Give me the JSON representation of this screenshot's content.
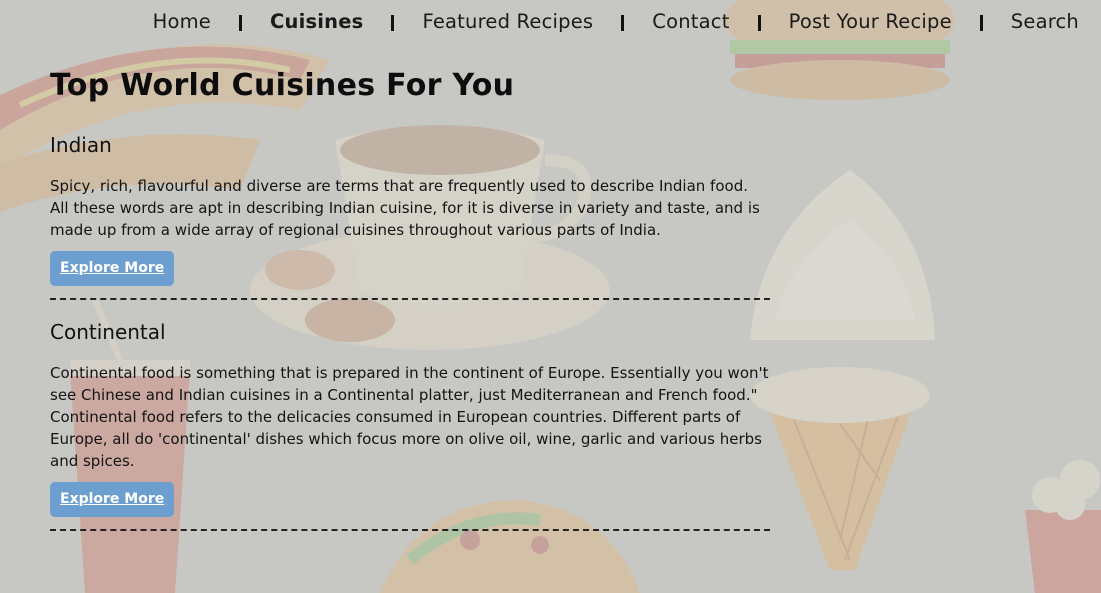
{
  "nav": {
    "items": [
      {
        "label": "Home",
        "active": false
      },
      {
        "label": "Cuisines",
        "active": true
      },
      {
        "label": "Featured Recipes",
        "active": false
      },
      {
        "label": "Contact",
        "active": false
      },
      {
        "label": "Post Your Recipe",
        "active": false
      },
      {
        "label": "Search",
        "active": false
      }
    ]
  },
  "page": {
    "title": "Top World Cuisines For You"
  },
  "cuisines": [
    {
      "name": "Indian",
      "description": "Spicy, rich, flavourful and diverse are terms that are frequently used to describe Indian food. All these words are apt in describing Indian cuisine, for it is diverse in variety and taste, and is made up from a wide array of regional cuisines throughout various parts of India.",
      "button_label": "Explore More"
    },
    {
      "name": "Continental",
      "description": "Continental food is something that is prepared in the continent of Europe. Essentially you won't see Chinese and Indian cuisines in a Continental platter, just Mediterranean and French food.\" Continental food refers to the delicacies consumed in European countries. Different parts of Europe, all do 'continental' dishes which focus more on olive oil, wine, garlic and various herbs and spices.",
      "button_label": "Explore More"
    }
  ],
  "colors": {
    "button": "#6c9fd0",
    "background": "#c9c9c6"
  }
}
